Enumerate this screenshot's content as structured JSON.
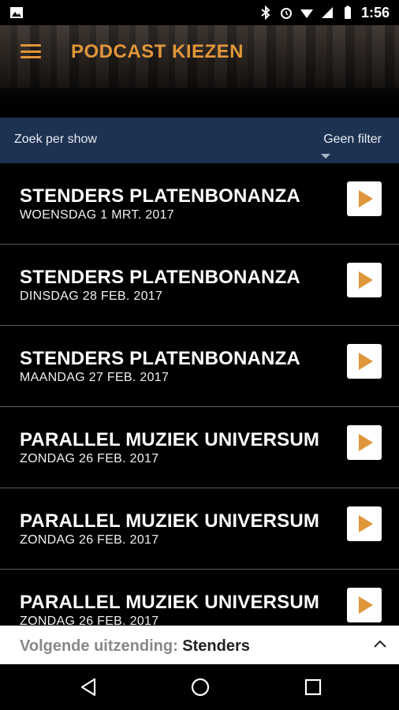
{
  "statusbar": {
    "time": "1:56"
  },
  "header": {
    "title": "PODCAST KIEZEN"
  },
  "filterbar": {
    "search_label": "Zoek per show",
    "filter_label": "Geen filter"
  },
  "episodes": [
    {
      "name": "STENDERS PLATENBONANZA",
      "date": "WOENSDAG 1 MRT. 2017"
    },
    {
      "name": "STENDERS PLATENBONANZA",
      "date": "DINSDAG 28 FEB. 2017"
    },
    {
      "name": "STENDERS PLATENBONANZA",
      "date": "MAANDAG 27 FEB. 2017"
    },
    {
      "name": "PARALLEL MUZIEK UNIVERSUM",
      "date": "ZONDAG 26 FEB. 2017"
    },
    {
      "name": "PARALLEL MUZIEK UNIVERSUM",
      "date": "ZONDAG 26 FEB. 2017"
    },
    {
      "name": "PARALLEL MUZIEK UNIVERSUM",
      "date": "ZONDAG 26 FEB. 2017"
    }
  ],
  "next_broadcast": {
    "label": "Volgende uitzending:",
    "show": "Stenders"
  },
  "icons": {
    "menu": "hamburger-menu-icon",
    "play": "play-icon",
    "chevron": "chevron-up-icon",
    "back": "back-icon",
    "home": "home-icon",
    "recents": "recents-icon"
  },
  "colors": {
    "accent": "#e0963a",
    "filterbar": "#1d3150"
  }
}
